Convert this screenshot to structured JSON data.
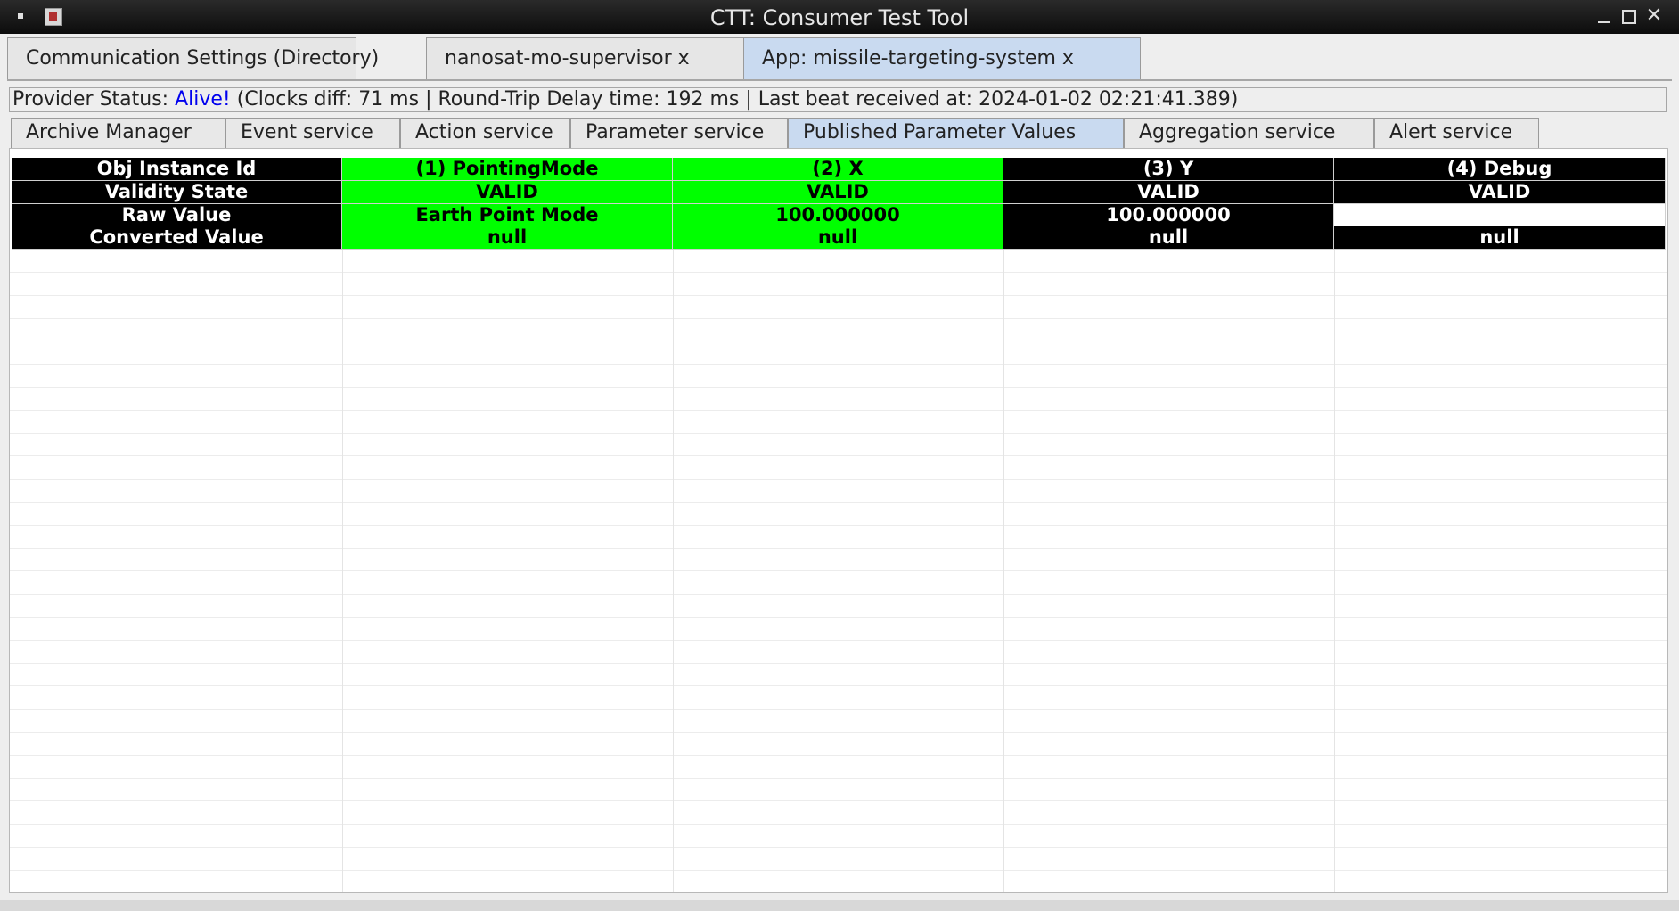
{
  "window": {
    "title": "CTT: Consumer Test Tool"
  },
  "outer_tabs": [
    {
      "label": "Communication Settings (Directory)"
    },
    {
      "label": "nanosat-mo-supervisor x"
    },
    {
      "label": "App: missile-targeting-system x",
      "active": true
    }
  ],
  "status": {
    "prefix": "Provider Status: ",
    "state": "Alive!",
    "details": " (Clocks diff: 71 ms | Round-Trip Delay time: 192 ms | Last beat received at: 2024-01-02 02:21:41.389)",
    "state_color": "#0000ee"
  },
  "inner_tabs": [
    {
      "label": "Archive Manager"
    },
    {
      "label": "Event service"
    },
    {
      "label": "Action service"
    },
    {
      "label": "Parameter service"
    },
    {
      "label": "Published Parameter Values",
      "active": true
    },
    {
      "label": "Aggregation service"
    },
    {
      "label": "Alert service"
    }
  ],
  "table": {
    "row_headers": [
      "Obj Instance Id",
      "Validity State",
      "Raw Value",
      "Converted Value"
    ],
    "columns": [
      {
        "header": "(1) PointingMode",
        "validity": "VALID",
        "raw": "Earth Point Mode",
        "converted": "null",
        "color": "green"
      },
      {
        "header": "(2) X",
        "validity": "VALID",
        "raw": "100.000000",
        "converted": "null",
        "color": "green"
      },
      {
        "header": "(3) Y",
        "validity": "VALID",
        "raw": "100.000000",
        "converted": "null",
        "color": "black"
      },
      {
        "header": "(4) Debug",
        "validity": "VALID",
        "raw": "",
        "converted": "null",
        "color": "black",
        "raw_color": "white"
      }
    ],
    "colors": {
      "green": "#00ff00",
      "black": "#000000",
      "white": "#ffffff"
    }
  }
}
